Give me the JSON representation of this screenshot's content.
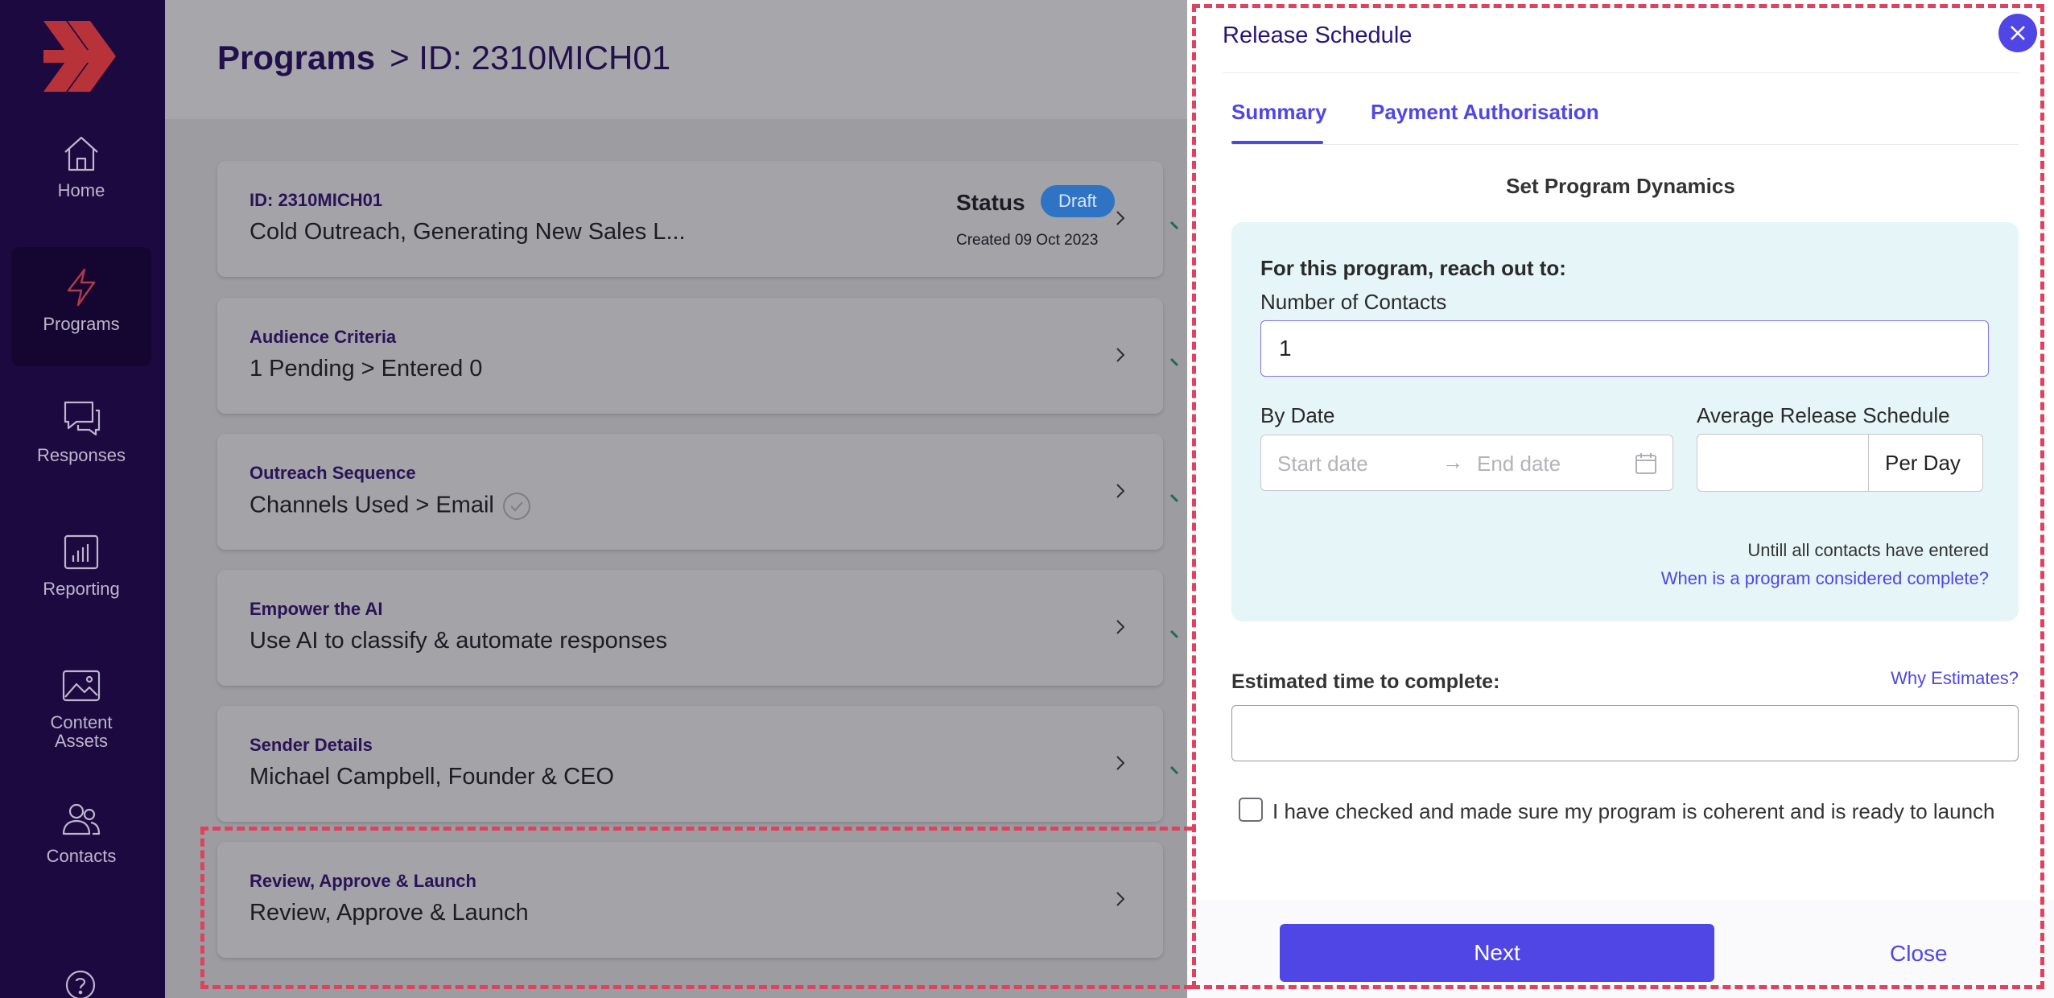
{
  "sidebar": {
    "items": [
      {
        "label": "Home",
        "icon": "home-icon"
      },
      {
        "label": "Programs",
        "icon": "lightning-icon",
        "active": true
      },
      {
        "label": "Responses",
        "icon": "chat-bubbles-icon"
      },
      {
        "label": "Reporting",
        "icon": "bar-chart-icon"
      },
      {
        "label": "Content Assets",
        "icon": "image-icon"
      },
      {
        "label": "Contacts",
        "icon": "users-icon"
      }
    ],
    "help_icon": "help-icon"
  },
  "header": {
    "title": "Programs",
    "breadcrumb": "> ID: 2310MICH01"
  },
  "cards": [
    {
      "label": "ID: 2310MICH01",
      "value": "Cold Outreach, Generating New Sales L...",
      "status_title": "Status",
      "status_badge": "Draft",
      "created": "Created 09 Oct 2023"
    },
    {
      "label": "Audience Criteria",
      "value": "1 Pending > Entered 0"
    },
    {
      "label": "Outreach Sequence",
      "value": "Channels Used > Email"
    },
    {
      "label": "Empower the AI",
      "value": "Use AI to classify & automate responses"
    },
    {
      "label": "Sender Details",
      "value": "Michael Campbell, Founder & CEO"
    },
    {
      "label": "Review, Approve & Launch",
      "value": "Review, Approve & Launch"
    }
  ],
  "panel": {
    "title": "Release Schedule",
    "tabs": [
      {
        "label": "Summary",
        "active": true
      },
      {
        "label": "Payment Authorisation"
      }
    ],
    "section_title": "Set Program Dynamics",
    "reach_heading": "For this program, reach out to:",
    "contacts_label": "Number of Contacts",
    "contacts_value": "1",
    "by_date_label": "By Date",
    "start_placeholder": "Start date",
    "end_placeholder": "End date",
    "avg_label": "Average Release Schedule",
    "avg_value": "",
    "per_unit": "Per Day",
    "until_text": "Untill all contacts have entered",
    "complete_link": "When is a program considered complete?",
    "est_label": "Estimated time to complete:",
    "why_link": "Why Estimates?",
    "est_value": "",
    "checkbox_label": "I have checked and made sure my program is coherent and is ready to launch",
    "next_label": "Next",
    "close_label": "Close"
  },
  "colors": {
    "sidebar_bg": "#1c0940",
    "accent": "#4f46e5",
    "logo": "#c93a3a",
    "badge": "#2f74c4",
    "highlight": "#e0415c",
    "dynamics_bg": "#e6f5f8"
  }
}
